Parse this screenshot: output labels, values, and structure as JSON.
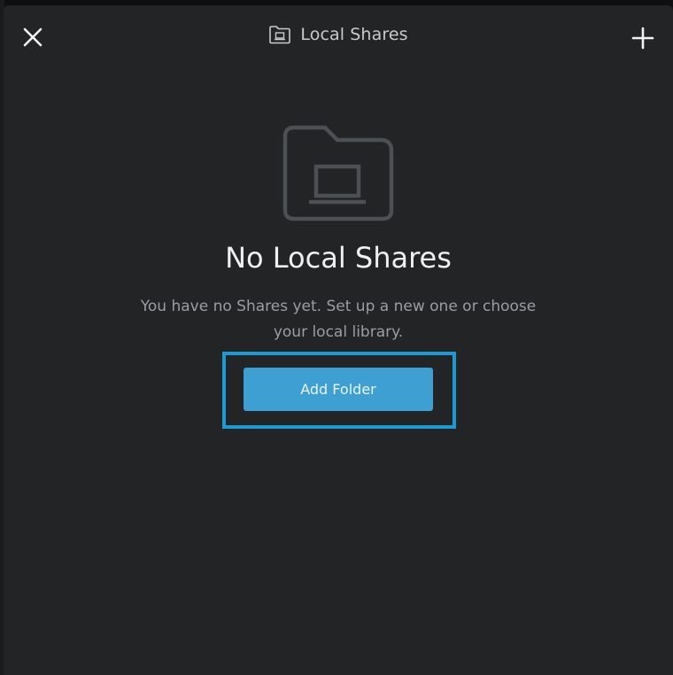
{
  "modal": {
    "title": "Local Shares",
    "title_icon": "folder-icon",
    "close_icon": "close-icon",
    "add_icon": "plus-icon"
  },
  "empty_state": {
    "icon": "folder-laptop-icon",
    "heading": "No Local Shares",
    "description_line1": "You have no Shares yet. Set up a new one or choose",
    "description_line2": "your local library.",
    "button_label": "Add Folder"
  },
  "colors": {
    "modal_background": "#222426",
    "button_primary": "#3e9fd3",
    "highlight_border": "#1b9ad6",
    "heading_text": "#eef0f1",
    "muted_text": "#9a9ea2"
  }
}
